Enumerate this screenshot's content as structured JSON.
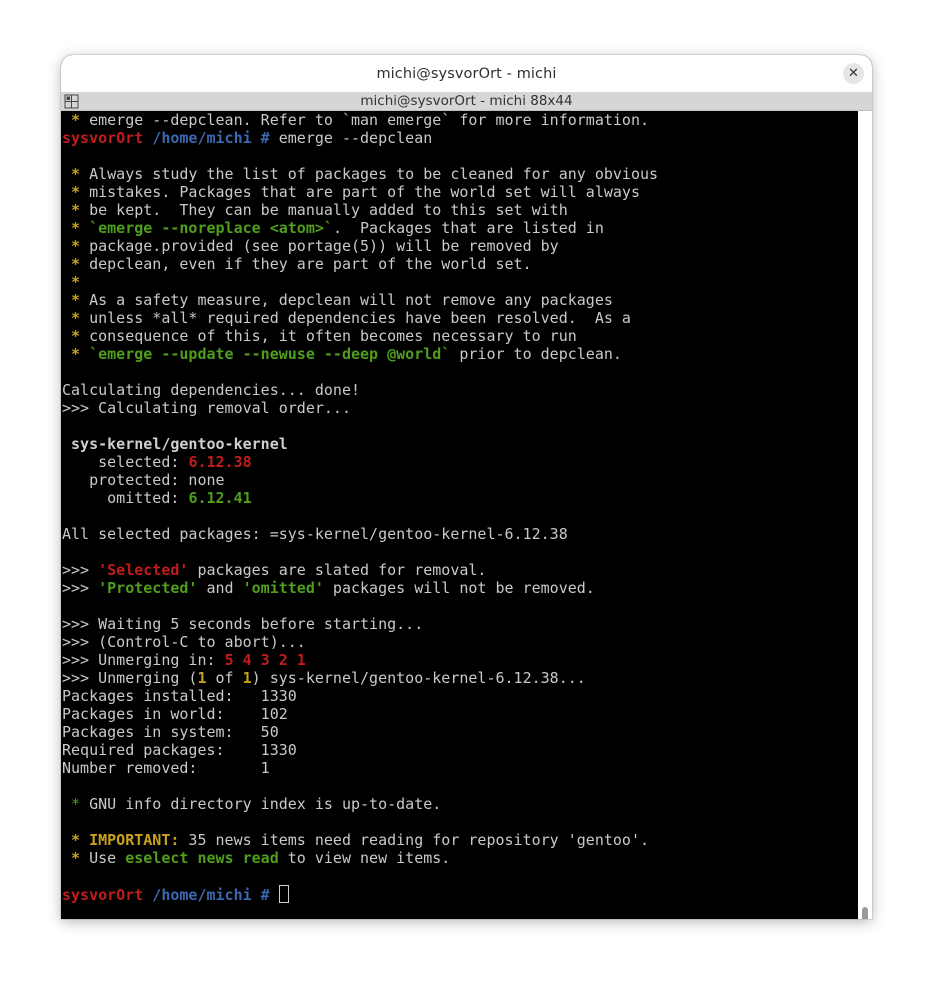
{
  "window": {
    "title": "michi@sysvorOrt - michi",
    "close_glyph": "✕"
  },
  "tab": {
    "title": "michi@sysvorOrt - michi 88x44",
    "icon": "grid-icon"
  },
  "terminal": {
    "l0": {
      "star": " *",
      "text": " emerge --depclean. Refer to `man emerge` for more information."
    },
    "l1": {
      "host": "sysvorOrt",
      "path": " /home/michi #",
      "cmd": " emerge --depclean"
    },
    "l3": {
      "star": " *",
      "text": " Always study the list of packages to be cleaned for any obvious"
    },
    "l4": {
      "star": " *",
      "text": " mistakes. Packages that are part of the world set will always"
    },
    "l5": {
      "star": " *",
      "text": " be kept.  They can be manually added to this set with"
    },
    "l6": {
      "star": " *",
      "sp": " ",
      "cmd": "`emerge --noreplace <atom>`",
      "text": ".  Packages that are listed in"
    },
    "l7": {
      "star": " *",
      "text": " package.provided (see portage(5)) will be removed by"
    },
    "l8": {
      "star": " *",
      "text": " depclean, even if they are part of the world set."
    },
    "l9": {
      "star": " *"
    },
    "l10": {
      "star": " *",
      "text": " As a safety measure, depclean will not remove any packages"
    },
    "l11": {
      "star": " *",
      "text": " unless *all* required dependencies have been resolved.  As a"
    },
    "l12": {
      "star": " *",
      "text": " consequence of this, it often becomes necessary to run"
    },
    "l13": {
      "star": " *",
      "sp": " ",
      "cmd": "`emerge --update --newuse --deep @world`",
      "text": " prior to depclean."
    },
    "l15": {
      "text": "Calculating dependencies... done!"
    },
    "l16": {
      "text": ">>> Calculating removal order..."
    },
    "l18": {
      "text": " sys-kernel/gentoo-kernel"
    },
    "l19": {
      "label": "    selected: ",
      "value": "6.12.38"
    },
    "l20": {
      "text": "   protected: none"
    },
    "l21": {
      "label": "     omitted: ",
      "value": "6.12.41"
    },
    "l23": {
      "text": "All selected packages: =sys-kernel/gentoo-kernel-6.12.38"
    },
    "l25": {
      "pre": ">>> ",
      "q": "'Selected'",
      "text": " packages are slated for removal."
    },
    "l26": {
      "pre": ">>> ",
      "q1": "'Protected'",
      "mid": " and ",
      "q2": "'omitted'",
      "text": " packages will not be removed."
    },
    "l28": {
      "text": ">>> Waiting 5 seconds before starting..."
    },
    "l29": {
      "text": ">>> (Control-C to abort)..."
    },
    "l30": {
      "pre": ">>> Unmerging in: ",
      "count": "5 4 3 2 1"
    },
    "l31": {
      "pre": ">>> Unmerging (",
      "n1": "1",
      "of": " of ",
      "n2": "1",
      "text": ") sys-kernel/gentoo-kernel-6.12.38..."
    },
    "l32": {
      "text": "Packages installed:   1330"
    },
    "l33": {
      "text": "Packages in world:    102"
    },
    "l34": {
      "text": "Packages in system:   50"
    },
    "l35": {
      "text": "Required packages:    1330"
    },
    "l36": {
      "text": "Number removed:       1"
    },
    "l38": {
      "star": " *",
      "text": " GNU info directory index is up-to-date."
    },
    "l40": {
      "star": " *",
      "sp": " ",
      "imp": "IMPORTANT:",
      "text": " 35 news items need reading for repository 'gentoo'."
    },
    "l41": {
      "star": " *",
      "pre": " Use ",
      "cmd": "eselect news read",
      "text": " to view new items."
    },
    "l43": {
      "host": "sysvorOrt",
      "path": " /home/michi #",
      "sp": " "
    }
  }
}
